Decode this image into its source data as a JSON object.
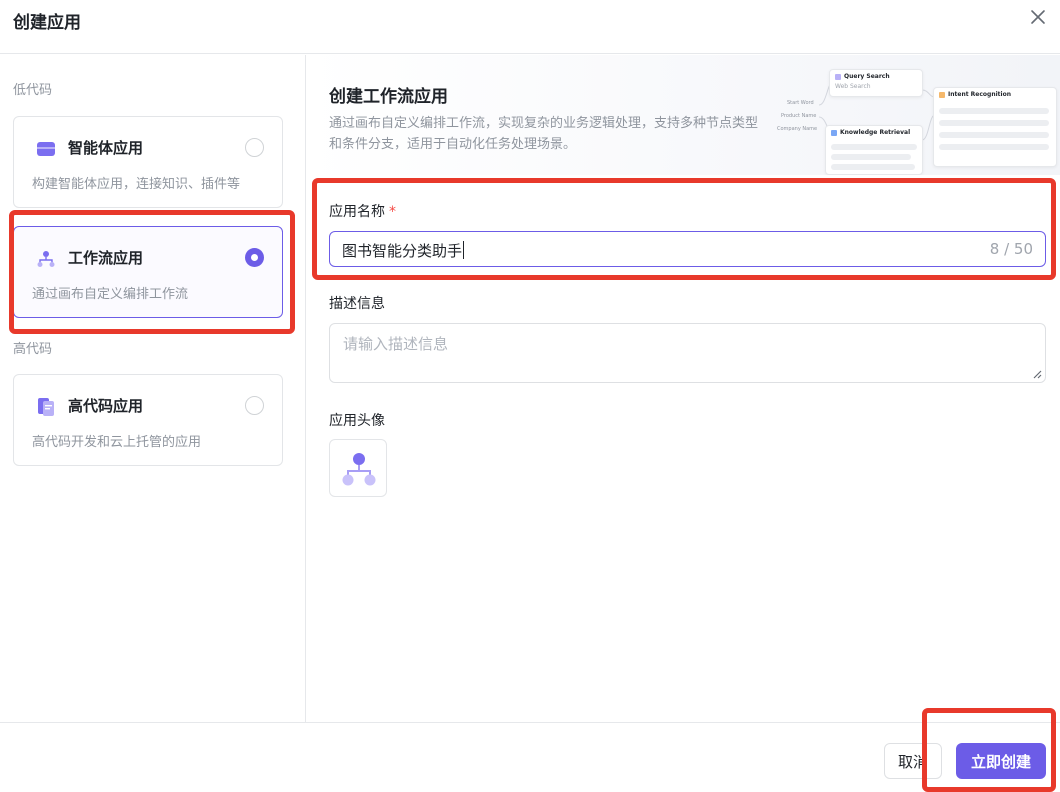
{
  "dialog": {
    "title": "创建应用"
  },
  "sidebar": {
    "groups": [
      {
        "label": "低代码",
        "items": [
          {
            "icon": "agent-app-icon",
            "title": "智能体应用",
            "desc": "构建智能体应用，连接知识、插件等",
            "selected": false
          },
          {
            "icon": "workflow-app-icon",
            "title": "工作流应用",
            "desc": "通过画布自定义编排工作流",
            "selected": true
          }
        ]
      },
      {
        "label": "高代码",
        "items": [
          {
            "icon": "code-app-icon",
            "title": "高代码应用",
            "desc": "高代码开发和云上托管的应用",
            "selected": false
          }
        ]
      }
    ]
  },
  "main": {
    "banner": {
      "title": "创建工作流应用",
      "desc": "通过画布自定义编排工作流，实现复杂的业务逻辑处理，支持多种节点类型和条件分支，适用于自动化任务处理场景。",
      "preview": {
        "node1_title": "Query Search",
        "node1_desc": "Web Search",
        "node2_title": "Knowledge Retrieval",
        "node3_title": "Intent Recognition",
        "side_labels": [
          "Start Word",
          "Product Name",
          "Company Name"
        ]
      }
    },
    "form": {
      "name_label": "应用名称",
      "required_mark": "*",
      "name_value": "图书智能分类助手",
      "name_count": "8 / 50",
      "desc_label": "描述信息",
      "desc_placeholder": "请输入描述信息",
      "avatar_label": "应用头像",
      "avatar_icon": "workflow-avatar-icon"
    }
  },
  "footer": {
    "cancel_label": "取消",
    "create_label": "立即创建"
  },
  "colors": {
    "accent": "#6c5ce7",
    "highlight": "#e8392b"
  }
}
